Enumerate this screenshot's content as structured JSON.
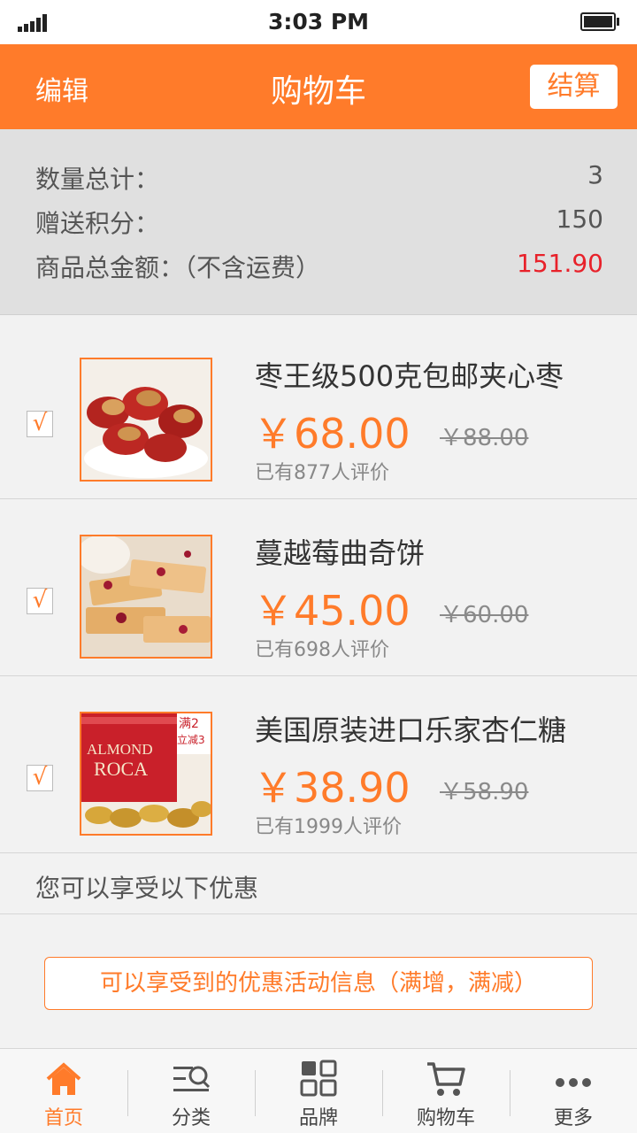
{
  "status_bar": {
    "time": "3:03 PM"
  },
  "header": {
    "edit_label": "编辑",
    "title": "购物车",
    "checkout_label": "结算"
  },
  "summary": {
    "quantity_label": "数量总计：",
    "quantity_value": "3",
    "points_label": "赠送积分：",
    "points_value": "150",
    "amount_label": "商品总金额：（不含运费）",
    "amount_value": "151.90"
  },
  "products": [
    {
      "checked": "√",
      "name": "枣王级500克包邮夹心枣",
      "price": "￥68.00",
      "old_price": "￥88.00",
      "reviews": "已有877人评价"
    },
    {
      "checked": "√",
      "name": "蔓越莓曲奇饼",
      "price": "￥45.00",
      "old_price": "￥60.00",
      "reviews": "已有698人评价"
    },
    {
      "checked": "√",
      "name": "美国原装进口乐家杏仁糖",
      "price": "￥38.90",
      "old_price": "￥58.90",
      "reviews": "已有1999人评价"
    }
  ],
  "product_image_text": {
    "brand_line1": "ALMOND",
    "brand_line2": "ROCA",
    "promo_line1": "满2",
    "promo_line2": "立减3"
  },
  "promo": {
    "title": "您可以享受以下优惠",
    "button_label": "可以享受到的优惠活动信息（满增，满减）"
  },
  "tabbar": {
    "items": [
      {
        "label": "首页",
        "icon": "home-icon"
      },
      {
        "label": "分类",
        "icon": "category-search-icon"
      },
      {
        "label": "品牌",
        "icon": "grid-icon"
      },
      {
        "label": "购物车",
        "icon": "cart-icon"
      },
      {
        "label": "更多",
        "icon": "more-icon"
      }
    ]
  },
  "colors": {
    "accent": "#ff7b2a",
    "price_red": "#e8212a",
    "summary_bg": "#e0e0e0"
  }
}
